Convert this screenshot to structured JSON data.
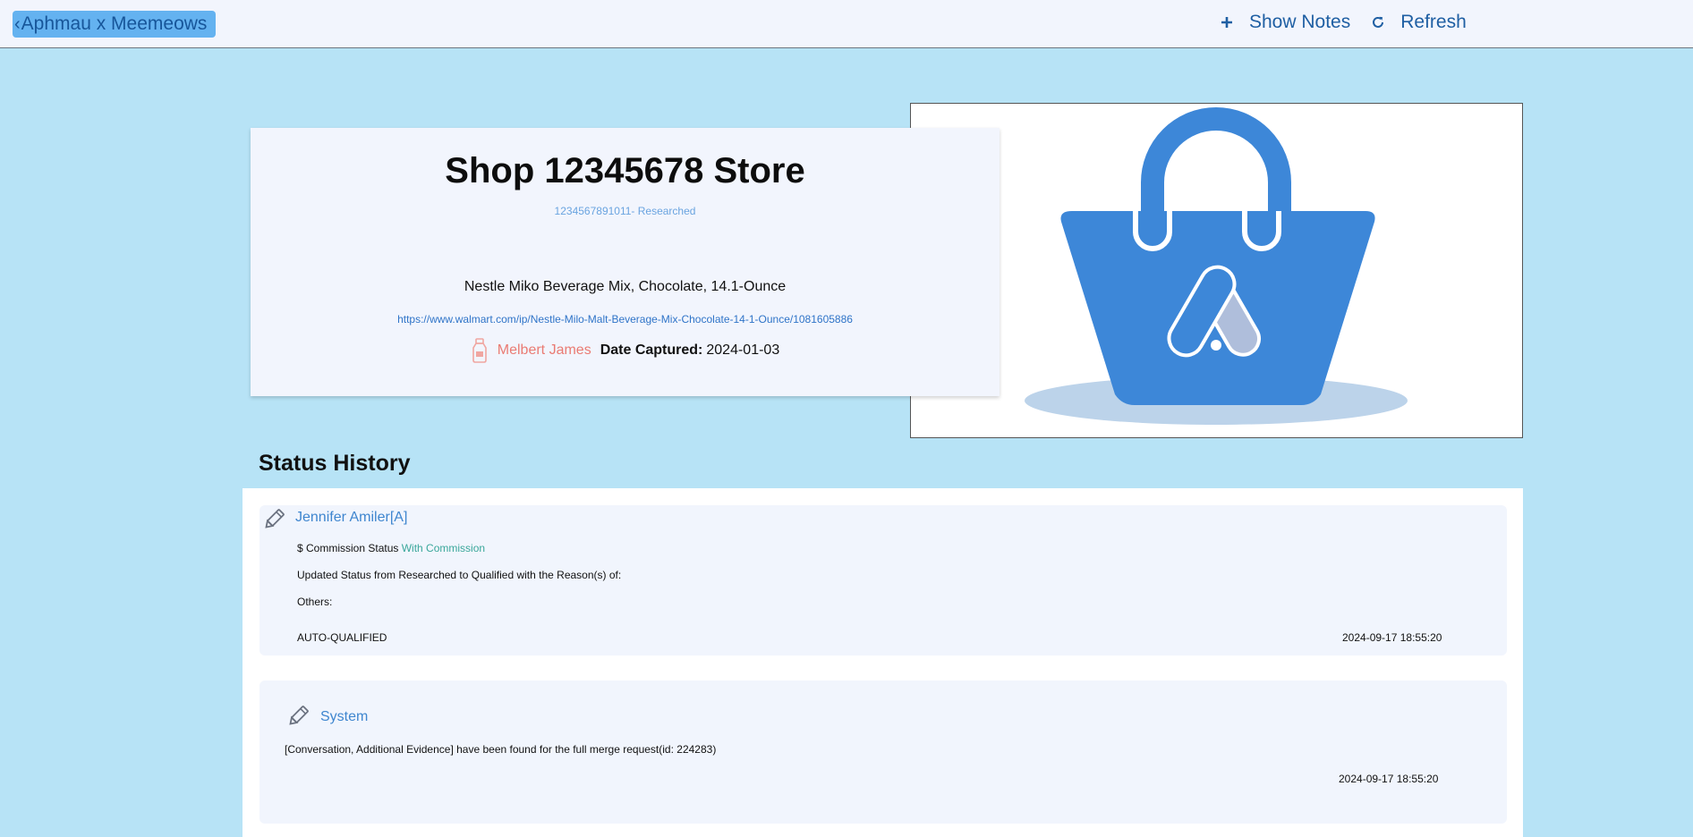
{
  "header": {
    "back_label": "Aphmau x Meemeows",
    "show_notes_label": "Show Notes",
    "refresh_label": "Refresh"
  },
  "shop": {
    "title": "Shop 12345678 Store",
    "subtitle": "1234567891011- Researched",
    "product_name": "Nestle Miko Beverage Mix, Chocolate, 14.1-Ounce",
    "product_url": "https://www.walmart.com/ip/Nestle-Milo-Malt-Beverage-Mix-Chocolate-14-1-Ounce/1081605886",
    "captured_by": "Melbert James",
    "date_label": "Date Captured:",
    "date_value": "2024-01-03"
  },
  "status_history": {
    "heading": "Status History",
    "items": [
      {
        "author": "Jennifer Amiler[A]",
        "commission_prefix": "$ Commission Status",
        "commission_value": "With Commission",
        "update_text": "Updated Status from Researched to Qualified with the Reason(s) of:",
        "others_text": "Others:",
        "reason": "AUTO-QUALIFIED",
        "timestamp": "2024-09-17 18:55:20"
      },
      {
        "author": "System",
        "message": "[Conversation, Additional Evidence] have been found for the full merge request(id: 224283)",
        "timestamp": "2024-09-17 18:55:20"
      }
    ]
  },
  "colors": {
    "page_bg": "#b7e3f6",
    "accent": "#3d87d8",
    "commission": "#3aa79b",
    "user_name": "#ea7b73"
  },
  "icons": {
    "back": "chevron-left-icon",
    "show_notes": "plus-icon",
    "refresh": "refresh-icon",
    "user": "bottle-icon",
    "history": "pencil-icon",
    "product_image": "shopping-bag-logo"
  }
}
